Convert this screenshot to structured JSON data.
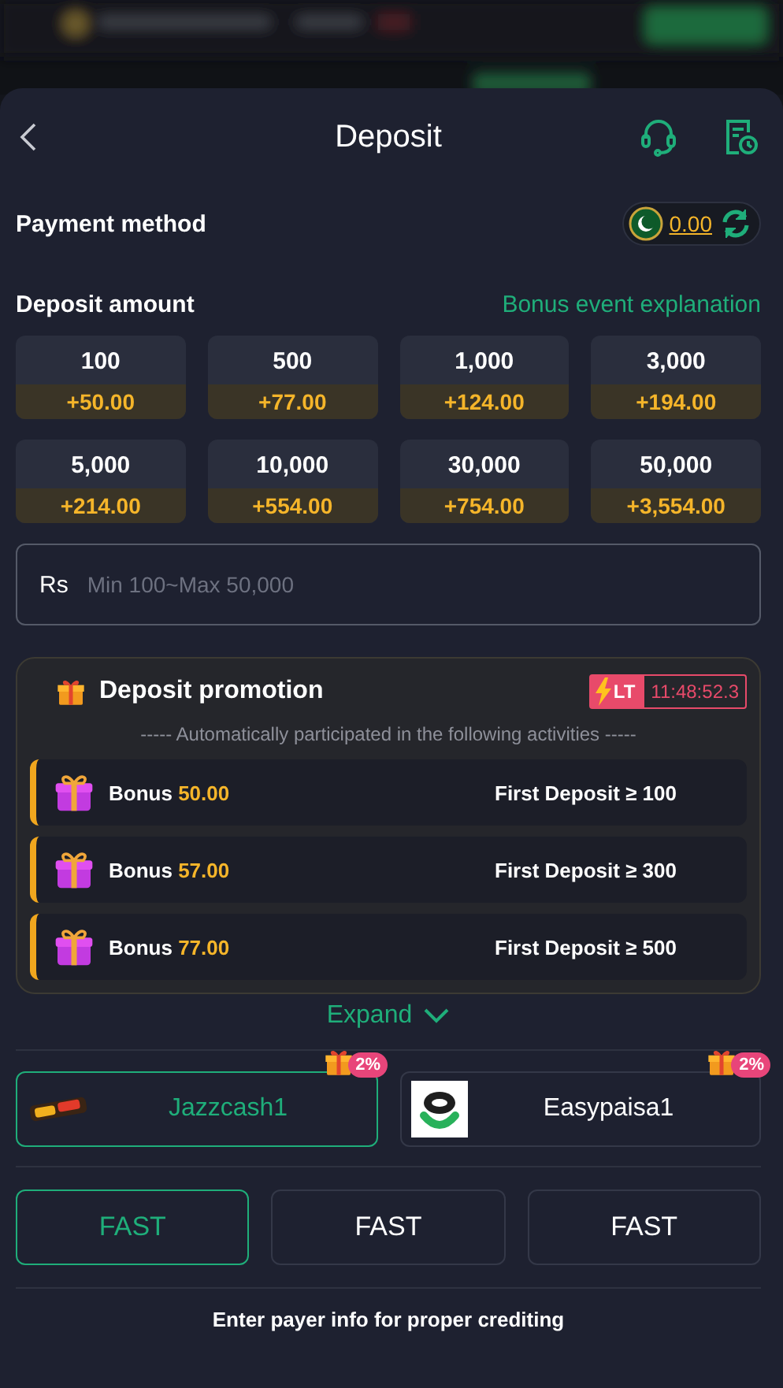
{
  "title": "Deposit",
  "payment_method": {
    "label": "Payment method",
    "balance": "0.00"
  },
  "deposit_amount": {
    "label": "Deposit amount",
    "link": "Bonus event explanation"
  },
  "amounts": [
    {
      "amount": "100",
      "bonus": "+50.00"
    },
    {
      "amount": "500",
      "bonus": "+77.00"
    },
    {
      "amount": "1,000",
      "bonus": "+124.00"
    },
    {
      "amount": "3,000",
      "bonus": "+194.00"
    },
    {
      "amount": "5,000",
      "bonus": "+214.00"
    },
    {
      "amount": "10,000",
      "bonus": "+554.00"
    },
    {
      "amount": "30,000",
      "bonus": "+754.00"
    },
    {
      "amount": "50,000",
      "bonus": "+3,554.00"
    }
  ],
  "amount_input": {
    "currency": "Rs",
    "placeholder": "Min 100~Max 50,000"
  },
  "promotion": {
    "title": "Deposit promotion",
    "timer_label": "LT",
    "timer": "11:48:52.3",
    "subtitle": "----- Automatically participated in the following activities -----",
    "items": [
      {
        "label": "Bonus",
        "amount": "50.00",
        "condition": "First Deposit ≥ 100"
      },
      {
        "label": "Bonus",
        "amount": "57.00",
        "condition": "First Deposit ≥ 300"
      },
      {
        "label": "Bonus",
        "amount": "77.00",
        "condition": "First Deposit ≥ 500"
      }
    ]
  },
  "expand": "Expand",
  "methods": [
    {
      "name": "Jazzcash1",
      "badge": "2%",
      "selected": true,
      "kind": "jazzcash"
    },
    {
      "name": "Easypaisa1",
      "badge": "2%",
      "selected": false,
      "kind": "easypaisa"
    }
  ],
  "channels": [
    {
      "label": "FAST",
      "selected": true
    },
    {
      "label": "FAST",
      "selected": false
    },
    {
      "label": "FAST",
      "selected": false
    }
  ],
  "footer": "Enter payer info for proper crediting"
}
